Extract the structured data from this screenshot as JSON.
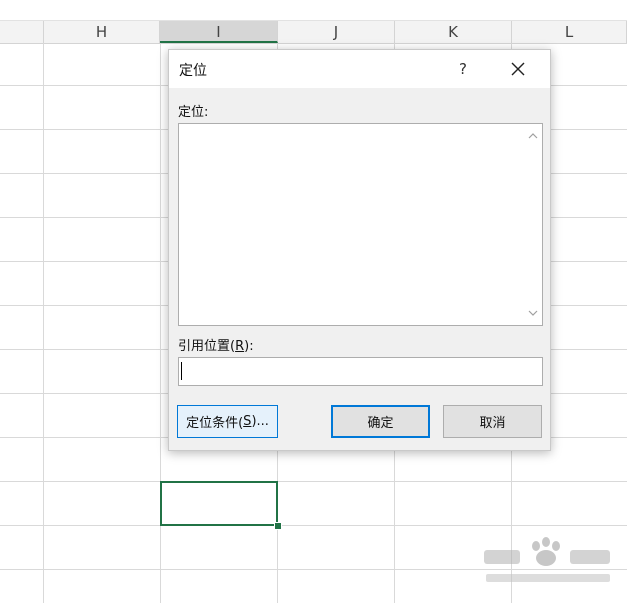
{
  "spreadsheet": {
    "columns": [
      "H",
      "I",
      "J",
      "K",
      "L"
    ],
    "selected_column": "I"
  },
  "dialog": {
    "title": "定位",
    "help_glyph": "?",
    "goto_label": "定位:",
    "goto_items": [],
    "reference_label_prefix": "引用位置(",
    "reference_label_key": "R",
    "reference_label_suffix": "):",
    "reference_value": "",
    "special_button": {
      "prefix": "定位条件(",
      "key": "S",
      "suffix": ")..."
    },
    "ok_label": "确定",
    "cancel_label": "取消"
  },
  "icons": {
    "close": "close-icon",
    "scroll_up": "chevron-up-icon",
    "scroll_down": "chevron-down-icon",
    "watermark": "baidu-jingyan-logo"
  },
  "colors": {
    "accent_green": "#217346",
    "focus_blue": "#0078d7",
    "dialog_bg": "#f0f0f0"
  }
}
